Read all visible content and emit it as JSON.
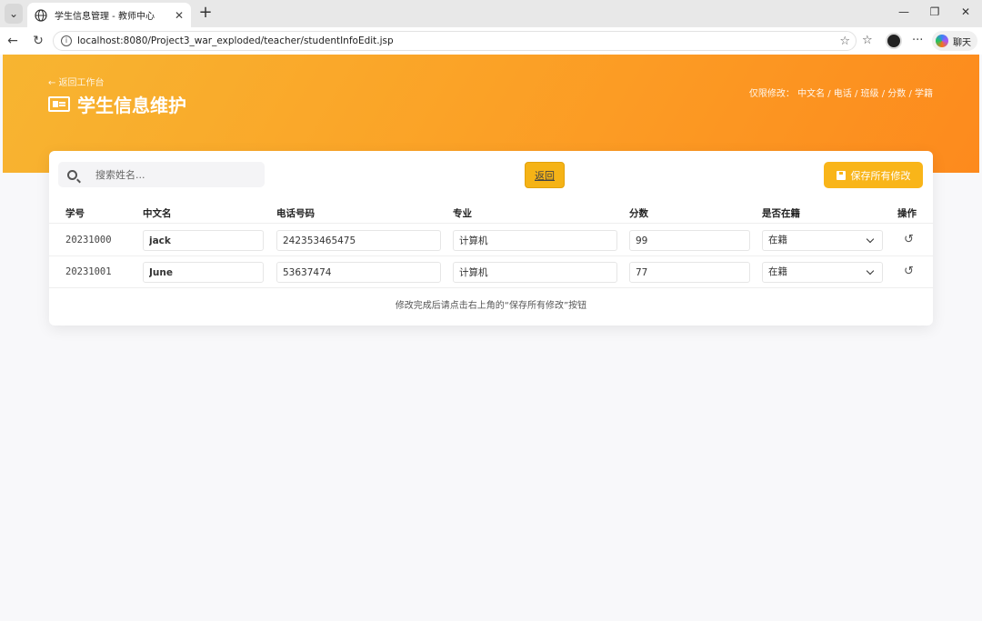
{
  "browser": {
    "tab_title": "学生信息管理 - 教师中心",
    "url": "localhost:8080/Project3_war_exploded/teacher/studentInfoEdit.jsp",
    "chat_label": "聊天"
  },
  "header": {
    "back_link": "← 返回工作台",
    "title": "学生信息维护",
    "hint": "仅限修改： 中文名 / 电话 / 班级 / 分数 / 学籍"
  },
  "toolbar": {
    "search_placeholder": "搜索姓名...",
    "return_label": "返回",
    "save_label": "保存所有修改"
  },
  "table": {
    "headers": [
      "学号",
      "中文名",
      "电话号码",
      "专业",
      "分数",
      "是否在籍",
      "操作"
    ],
    "rows": [
      {
        "id": "20231000",
        "name": "jack",
        "phone": "242353465475",
        "major": "计算机",
        "score": "99",
        "status": "在籍"
      },
      {
        "id": "20231001",
        "name": "June",
        "phone": "53637474",
        "major": "计算机",
        "score": "77",
        "status": "在籍"
      }
    ]
  },
  "footnote": "修改完成后请点击右上角的“保存所有修改”按钮",
  "colors": {
    "accent": "#f9b519",
    "hero_start": "#f7b531",
    "hero_end": "#fd8a1d"
  }
}
